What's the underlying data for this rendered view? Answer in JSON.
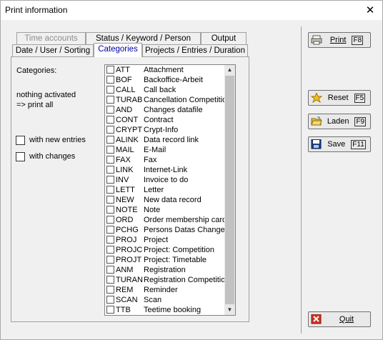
{
  "window": {
    "title": "Print information",
    "close_glyph": "✕"
  },
  "tabs": {
    "row_top": [
      "Time accounts",
      "Status / Keyword / Person",
      "Output"
    ],
    "row_bottom": [
      "Date / User / Sorting",
      "Categories",
      "Projects / Entries / Duration"
    ]
  },
  "panel": {
    "categories_label": "Categories:",
    "status_line1": "nothing activated",
    "status_line2": "=> print all",
    "with_new_entries": "with new entries",
    "with_changes": "with changes"
  },
  "categories": [
    {
      "code": "ATT",
      "desc": "Attachment"
    },
    {
      "code": "BOF",
      "desc": "Backoffice-Arbeit"
    },
    {
      "code": "CALL",
      "desc": "Call back"
    },
    {
      "code": "TURAB",
      "desc": "Cancellation Competition"
    },
    {
      "code": "AND",
      "desc": "Changes datafile"
    },
    {
      "code": "CONT",
      "desc": "Contract"
    },
    {
      "code": "CRYPT",
      "desc": "Crypt-Info"
    },
    {
      "code": "ALINK",
      "desc": "Data record link"
    },
    {
      "code": "MAIL",
      "desc": "E-Mail"
    },
    {
      "code": "FAX",
      "desc": "Fax"
    },
    {
      "code": "LINK",
      "desc": "Internet-Link"
    },
    {
      "code": "INV",
      "desc": "Invoice to do"
    },
    {
      "code": "LETT",
      "desc": "Letter"
    },
    {
      "code": "NEW",
      "desc": "New data record"
    },
    {
      "code": "NOTE",
      "desc": "Note"
    },
    {
      "code": "ORD",
      "desc": "Order membership card"
    },
    {
      "code": "PCHG",
      "desc": "Persons Datas Changes"
    },
    {
      "code": "PROJ",
      "desc": "Project"
    },
    {
      "code": "PROJC",
      "desc": "Project: Competition"
    },
    {
      "code": "PROJT",
      "desc": "Project: Timetable"
    },
    {
      "code": "ANM",
      "desc": "Registration"
    },
    {
      "code": "TURAN",
      "desc": "Registration Competition"
    },
    {
      "code": "REM",
      "desc": "Reminder"
    },
    {
      "code": "SCAN",
      "desc": "Scan"
    },
    {
      "code": "TTB",
      "desc": "Teetime booking"
    }
  ],
  "buttons": {
    "print": {
      "label": "Print",
      "key": "F8"
    },
    "reset": {
      "label": "Reset",
      "key": "F5"
    },
    "laden": {
      "label": "Laden",
      "key": "F9"
    },
    "save": {
      "label": "Save",
      "key": "F11"
    },
    "quit": {
      "label": "Quit"
    }
  },
  "colors": {
    "active_tab_text": "#0000a0",
    "disabled_tab_text": "#8c8c8c",
    "quit_icon": "#d03020",
    "save_icon": "#1a3e8c"
  }
}
